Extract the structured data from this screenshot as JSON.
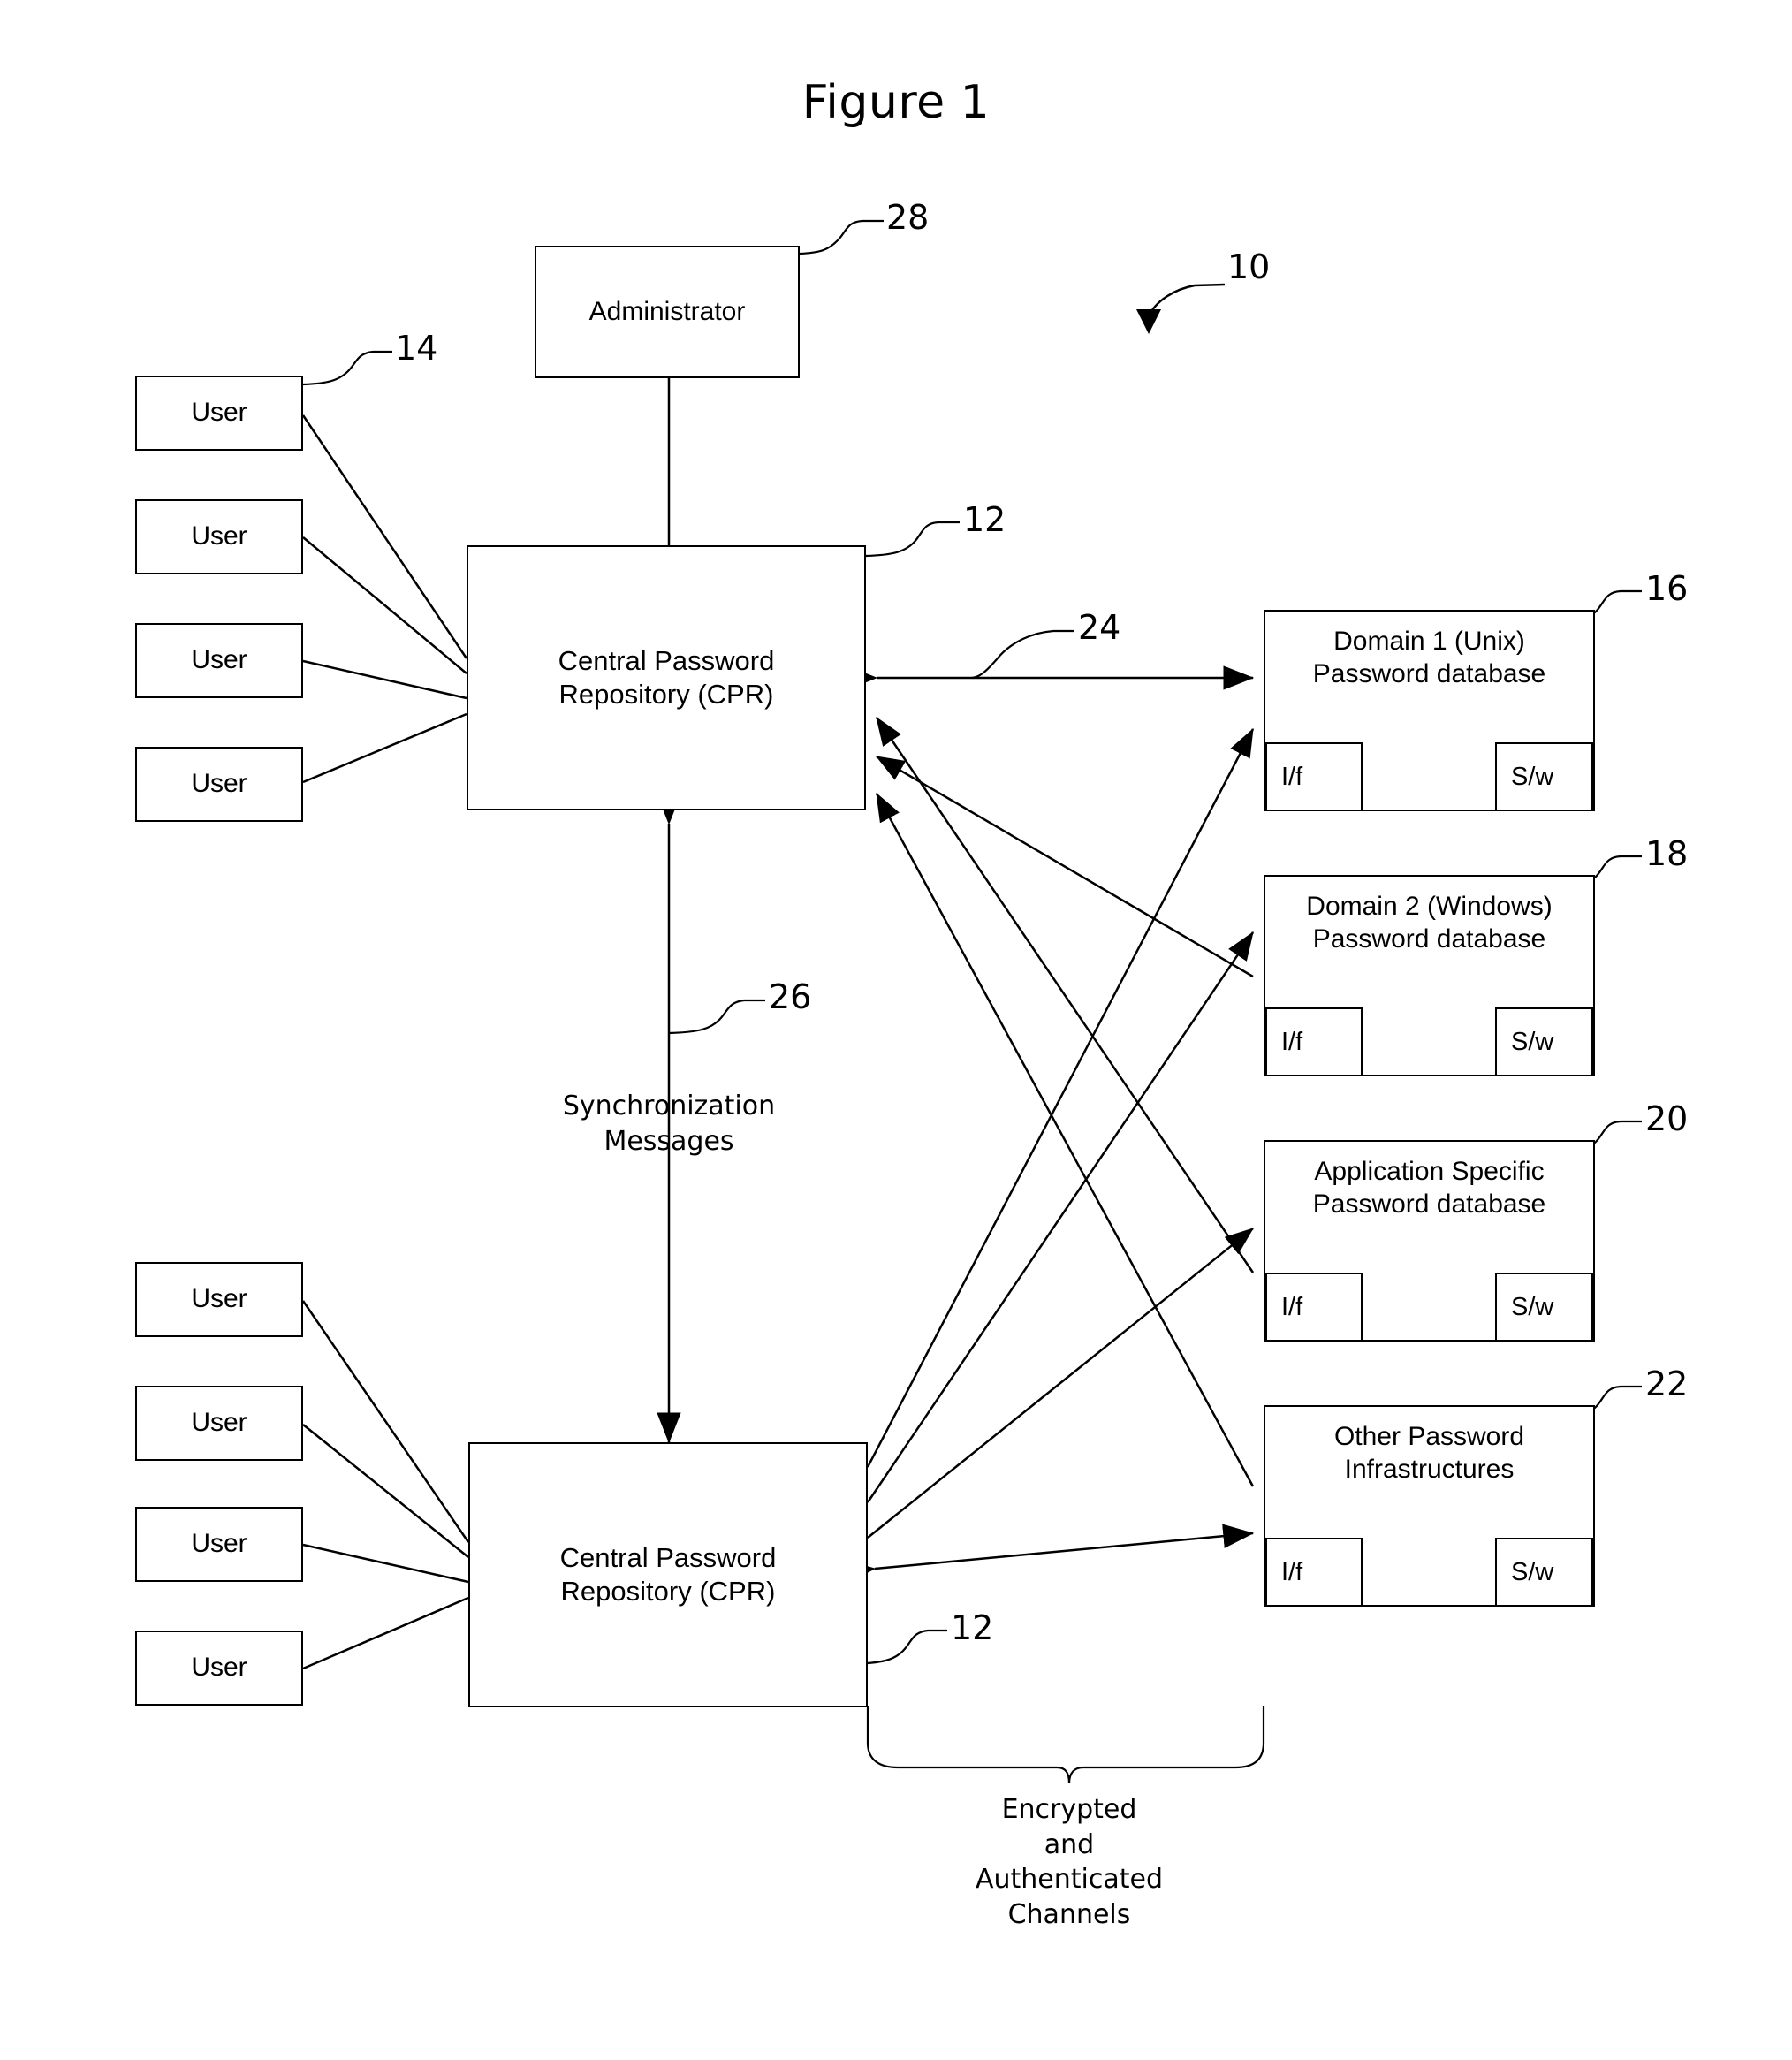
{
  "figure": {
    "title": "Figure 1",
    "system_ref": "10"
  },
  "nodes": {
    "administrator": {
      "label": "Administrator",
      "ref": "28"
    },
    "cpr_top": {
      "label": "Central Password\nRepository (CPR)",
      "ref": "12"
    },
    "cpr_bottom": {
      "label": "Central Password\nRepository (CPR)",
      "ref": "12"
    },
    "users_top": [
      {
        "label": "User",
        "ref": "14"
      },
      {
        "label": "User"
      },
      {
        "label": "User"
      },
      {
        "label": "User"
      }
    ],
    "users_bottom": [
      {
        "label": "User"
      },
      {
        "label": "User"
      },
      {
        "label": "User"
      },
      {
        "label": "User"
      }
    ],
    "databases": [
      {
        "label": "Domain 1 (Unix)\nPassword database",
        "ref": "16",
        "iface": "I/f",
        "software": "S/w"
      },
      {
        "label": "Domain 2 (Windows)\nPassword database",
        "ref": "18",
        "iface": "I/f",
        "software": "S/w"
      },
      {
        "label": "Application Specific\nPassword database",
        "ref": "20",
        "iface": "I/f",
        "software": "S/w"
      },
      {
        "label": "Other Password\nInfrastructures",
        "ref": "22",
        "iface": "I/f",
        "software": "S/w"
      }
    ]
  },
  "annotations": {
    "channel_ref": "24",
    "sync_ref": "26",
    "sync_label": "Synchronization\nMessages",
    "brace_label": "Encrypted\nand\nAuthenticated\nChannels"
  },
  "style": {
    "stroke": "#000000",
    "background": "#ffffff"
  }
}
